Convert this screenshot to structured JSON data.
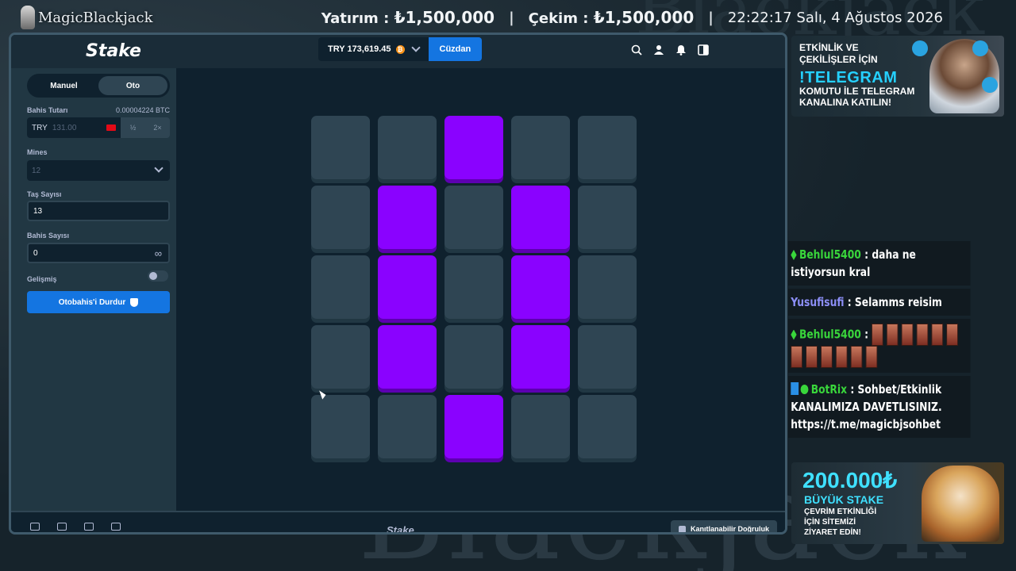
{
  "overlay": {
    "brand": "MagicBlackjack",
    "deposit_label": "Yatırım :",
    "deposit_value": "₺1,500,000",
    "withdraw_label": "Çekim :",
    "withdraw_value": "₺1,500,000",
    "separator": "|",
    "datetime": "22:22:17 Salı, 4 Ağustos 2026"
  },
  "header": {
    "logo": "Stake",
    "balance": "TRY 173,619.45",
    "wallet_button": "Cüzdan"
  },
  "sidebar": {
    "tabs": [
      {
        "label": "Manuel",
        "active": false
      },
      {
        "label": "Oto",
        "active": true
      }
    ],
    "bet_amount_label": "Bahis Tutarı",
    "bet_amount_btc": "0.00004224 BTC",
    "bet_currency": "TRY",
    "bet_amount_value": "131.00",
    "half_label": "½",
    "double_label": "2×",
    "mines_label": "Mines",
    "mines_value": "12",
    "gems_label": "Taş Sayısı",
    "gems_value": "13",
    "bet_count_label": "Bahis Sayısı",
    "bet_count_value": "0",
    "infinity_symbol": "∞",
    "advanced_label": "Gelişmiş",
    "advanced_on": false,
    "stop_button": "Otobahis'i Durdur"
  },
  "board": {
    "rows": 5,
    "cols": 5,
    "selected": [
      [
        0,
        2
      ],
      [
        1,
        1
      ],
      [
        1,
        3
      ],
      [
        2,
        1
      ],
      [
        2,
        3
      ],
      [
        3,
        1
      ],
      [
        3,
        3
      ],
      [
        4,
        2
      ]
    ]
  },
  "footer": {
    "logo": "Stake",
    "fairness": "Kanıtlanabilir Doğruluk"
  },
  "promo_telegram": {
    "line1": "ETKİNLİK VE",
    "line2": "ÇEKİLİŞLER İÇİN",
    "headline": "!TELEGRAM",
    "line3": "KOMUTU İLE TELEGRAM",
    "line4": "KANALINA KATILIN!"
  },
  "chat": [
    {
      "user": "Behlul5400",
      "text": ": daha ne istiyorsun kral"
    },
    {
      "user": "Yusufisufi",
      "text": ": Selamms reisim"
    },
    {
      "user": "Behlul5400",
      "text": ":",
      "emotes": 12
    },
    {
      "user": "BotRix",
      "text": ": Sohbet/Etkinlik KANALIMIZA DAVETLISINIZ. https://t.me/magicbjsohbet"
    }
  ],
  "promo_zeus": {
    "amount": "200.000₺",
    "line1": "BÜYÜK STAKE",
    "line2": "ÇEVRİM ETKİNLİĞİ",
    "line3": "İÇİN SİTEMİZİ",
    "line4": "ZİYARET EDİN!"
  },
  "colors": {
    "accent": "#1475e1",
    "tile": "#2f4553",
    "gem_selected": "#8a02ff",
    "chat_user_green": "#39d63b",
    "chat_user_blue": "#8d8ff7"
  }
}
